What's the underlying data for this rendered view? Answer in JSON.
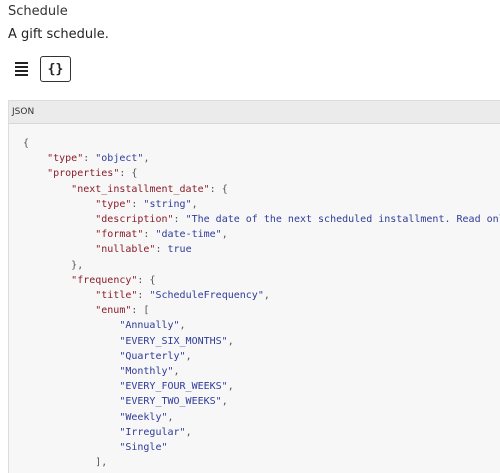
{
  "header": {
    "title": "Schedule",
    "description": "A gift schedule."
  },
  "toolbar": {
    "list_view_icon": "list-lines-icon",
    "json_view_label": "{}"
  },
  "panel": {
    "label": "JSON"
  },
  "code_lines": [
    [
      {
        "t": "{",
        "c": "p"
      }
    ],
    [
      {
        "t": "    "
      },
      {
        "t": "\"type\"",
        "c": "k"
      },
      {
        "t": ": ",
        "c": "p"
      },
      {
        "t": "\"object\"",
        "c": "s"
      },
      {
        "t": ",",
        "c": "p"
      }
    ],
    [
      {
        "t": "    "
      },
      {
        "t": "\"properties\"",
        "c": "k"
      },
      {
        "t": ": {",
        "c": "p"
      }
    ],
    [
      {
        "t": "        "
      },
      {
        "t": "\"next_installment_date\"",
        "c": "k"
      },
      {
        "t": ": {",
        "c": "p"
      }
    ],
    [
      {
        "t": "            "
      },
      {
        "t": "\"type\"",
        "c": "k"
      },
      {
        "t": ": ",
        "c": "p"
      },
      {
        "t": "\"string\"",
        "c": "s"
      },
      {
        "t": ",",
        "c": "p"
      }
    ],
    [
      {
        "t": "            "
      },
      {
        "t": "\"description\"",
        "c": "k"
      },
      {
        "t": ": ",
        "c": "p"
      },
      {
        "t": "\"The date of the next scheduled installment. Read only.\"",
        "c": "s"
      },
      {
        "t": ",",
        "c": "p"
      }
    ],
    [
      {
        "t": "            "
      },
      {
        "t": "\"format\"",
        "c": "k"
      },
      {
        "t": ": ",
        "c": "p"
      },
      {
        "t": "\"date-time\"",
        "c": "s"
      },
      {
        "t": ",",
        "c": "p"
      }
    ],
    [
      {
        "t": "            "
      },
      {
        "t": "\"nullable\"",
        "c": "k"
      },
      {
        "t": ": ",
        "c": "p"
      },
      {
        "t": "true",
        "c": "s"
      }
    ],
    [
      {
        "t": "        "
      },
      {
        "t": "},",
        "c": "p"
      }
    ],
    [
      {
        "t": "        "
      },
      {
        "t": "\"frequency\"",
        "c": "k"
      },
      {
        "t": ": {",
        "c": "p"
      }
    ],
    [
      {
        "t": "            "
      },
      {
        "t": "\"title\"",
        "c": "k"
      },
      {
        "t": ": ",
        "c": "p"
      },
      {
        "t": "\"ScheduleFrequency\"",
        "c": "s"
      },
      {
        "t": ",",
        "c": "p"
      }
    ],
    [
      {
        "t": "            "
      },
      {
        "t": "\"enum\"",
        "c": "k"
      },
      {
        "t": ": [",
        "c": "p"
      }
    ],
    [
      {
        "t": "                "
      },
      {
        "t": "\"Annually\"",
        "c": "s"
      },
      {
        "t": ",",
        "c": "p"
      }
    ],
    [
      {
        "t": "                "
      },
      {
        "t": "\"EVERY_SIX_MONTHS\"",
        "c": "s"
      },
      {
        "t": ",",
        "c": "p"
      }
    ],
    [
      {
        "t": "                "
      },
      {
        "t": "\"Quarterly\"",
        "c": "s"
      },
      {
        "t": ",",
        "c": "p"
      }
    ],
    [
      {
        "t": "                "
      },
      {
        "t": "\"Monthly\"",
        "c": "s"
      },
      {
        "t": ",",
        "c": "p"
      }
    ],
    [
      {
        "t": "                "
      },
      {
        "t": "\"EVERY_FOUR_WEEKS\"",
        "c": "s"
      },
      {
        "t": ",",
        "c": "p"
      }
    ],
    [
      {
        "t": "                "
      },
      {
        "t": "\"EVERY_TWO_WEEKS\"",
        "c": "s"
      },
      {
        "t": ",",
        "c": "p"
      }
    ],
    [
      {
        "t": "                "
      },
      {
        "t": "\"Weekly\"",
        "c": "s"
      },
      {
        "t": ",",
        "c": "p"
      }
    ],
    [
      {
        "t": "                "
      },
      {
        "t": "\"Irregular\"",
        "c": "s"
      },
      {
        "t": ",",
        "c": "p"
      }
    ],
    [
      {
        "t": "                "
      },
      {
        "t": "\"Single\"",
        "c": "s"
      }
    ],
    [
      {
        "t": "            "
      },
      {
        "t": "],",
        "c": "p"
      }
    ]
  ]
}
